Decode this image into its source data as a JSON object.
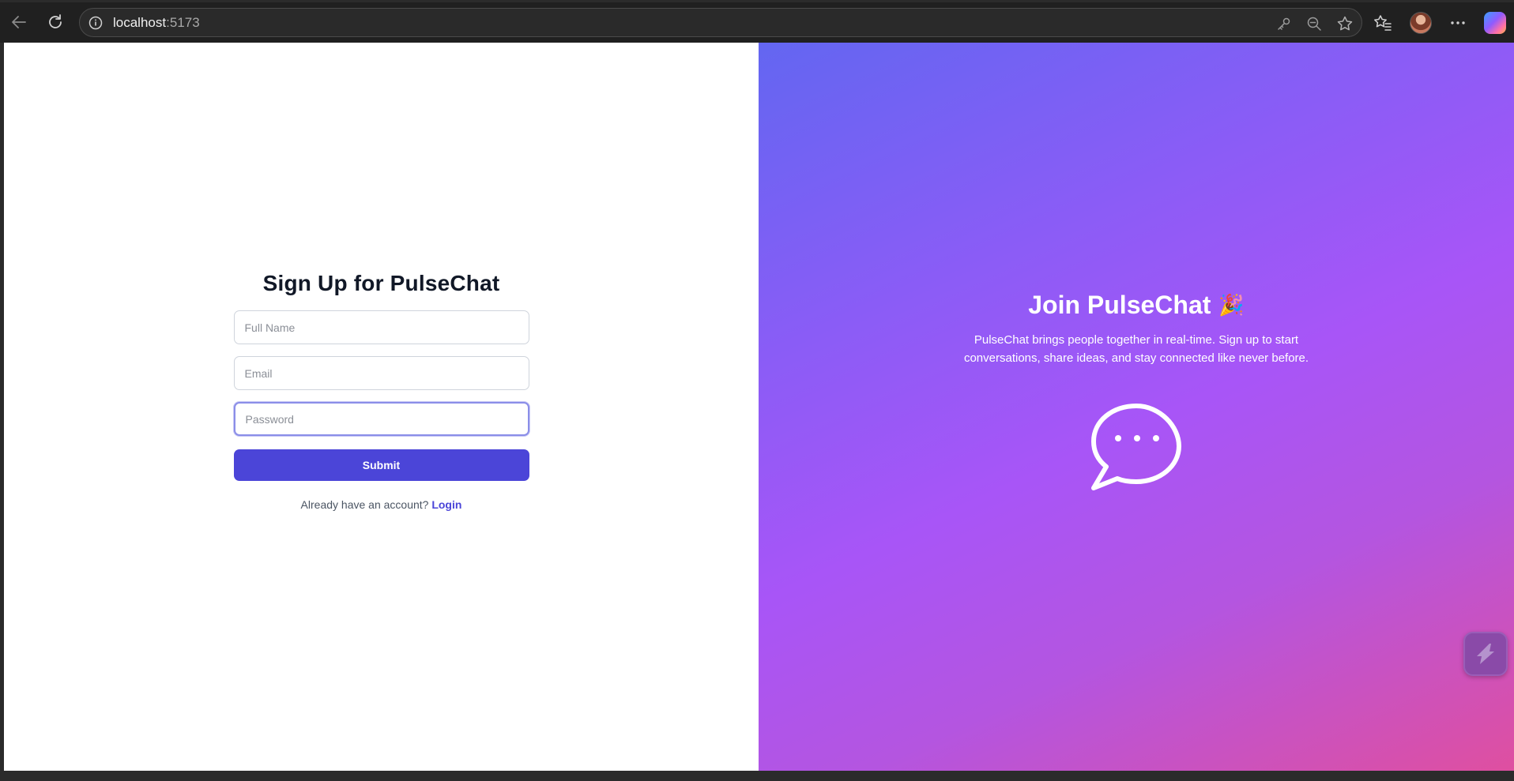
{
  "browser": {
    "url_host": "localhost",
    "url_port": ":5173",
    "icons": [
      "back-icon",
      "reload-icon",
      "site-info-icon",
      "key-icon",
      "zoom-out-icon",
      "favorite-star-icon",
      "favorites-icon",
      "avatar",
      "more-icon",
      "copilot-icon"
    ]
  },
  "signup": {
    "title": "Sign Up for PulseChat",
    "full_name_placeholder": "Full Name",
    "email_placeholder": "Email",
    "password_placeholder": "Password",
    "submit_label": "Submit",
    "have_account_text": "Already have an account?",
    "login_link": "Login"
  },
  "promo": {
    "title": "Join PulseChat",
    "emoji": "🎉",
    "description": "PulseChat brings people together in real-time. Sign up to start conversations, share ideas, and stay connected like never before."
  },
  "colors": {
    "primary": "#4b45d8",
    "gradient_start": "#6366f1",
    "gradient_mid": "#a855f7",
    "gradient_end": "#df4fa0"
  }
}
